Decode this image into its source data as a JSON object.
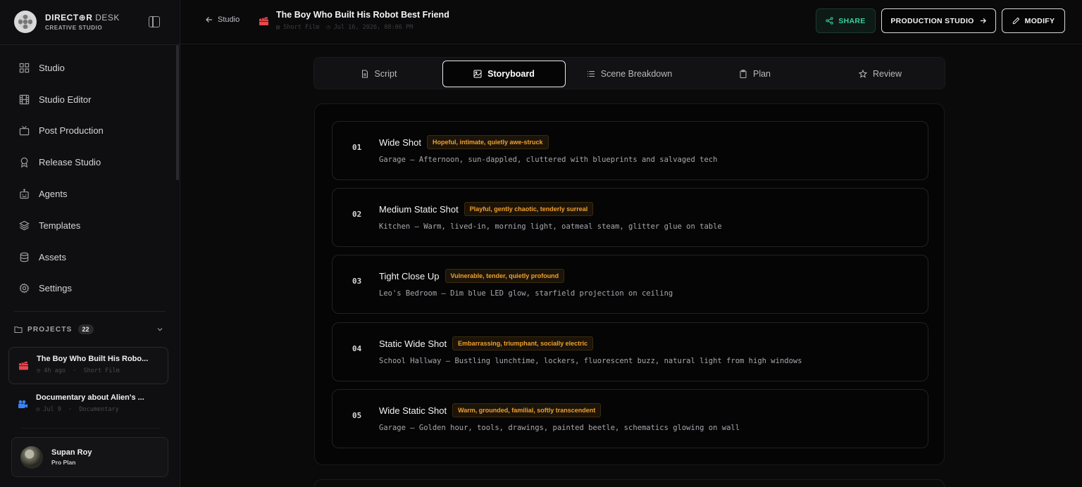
{
  "brand": {
    "name_bold": "DIRECT⊕R",
    "name_light": "DESK",
    "subtitle": "CREATIVE STUDIO"
  },
  "sidebar": {
    "items": [
      {
        "label": "Studio",
        "icon": "grid-icon"
      },
      {
        "label": "Studio Editor",
        "icon": "film-icon"
      },
      {
        "label": "Post Production",
        "icon": "tv-icon"
      },
      {
        "label": "Release Studio",
        "icon": "award-icon"
      },
      {
        "label": "Agents",
        "icon": "bot-icon"
      },
      {
        "label": "Templates",
        "icon": "layers-icon"
      },
      {
        "label": "Assets",
        "icon": "database-icon"
      },
      {
        "label": "Settings",
        "icon": "gear-icon"
      }
    ],
    "projects_label": "PROJECTS",
    "projects_count": "22",
    "projects": [
      {
        "title": "The Boy Who Built His Robo...",
        "time": "4h ago",
        "type": "Short Film",
        "icon": "clapperboard-icon",
        "icon_color": "#e5484d"
      },
      {
        "title": "Documentary about Alien's ...",
        "time": "Jul 9",
        "type": "Documentary",
        "icon": "video-camera-icon",
        "icon_color": "#3b82f6"
      }
    ],
    "user": {
      "name": "Supan Roy",
      "plan": "Pro Plan"
    }
  },
  "header": {
    "back_label": "Studio",
    "title": "The Boy Who Built His Robot Best Friend",
    "meta_type": "Short Film",
    "meta_date": "Jul 16, 2026, 08:06 PM",
    "share_label": "SHARE",
    "production_label": "PRODUCTION STUDIO",
    "modify_label": "MODIFY",
    "share_color": "#3ecf9a"
  },
  "tabs": [
    {
      "label": "Script",
      "icon": "document-icon"
    },
    {
      "label": "Storyboard",
      "icon": "image-icon",
      "active": true
    },
    {
      "label": "Scene Breakdown",
      "icon": "list-icon"
    },
    {
      "label": "Plan",
      "icon": "clipboard-icon"
    },
    {
      "label": "Review",
      "icon": "star-icon"
    }
  ],
  "shots": [
    {
      "num": "01",
      "title": "Wide Shot",
      "mood": "Hopeful, intimate, quietly awe-struck",
      "desc": "Garage — Afternoon, sun-dappled, cluttered with blueprints and salvaged tech"
    },
    {
      "num": "02",
      "title": "Medium Static Shot",
      "mood": "Playful, gently chaotic, tenderly surreal",
      "desc": "Kitchen — Warm, lived-in, morning light, oatmeal steam, glitter glue on table"
    },
    {
      "num": "03",
      "title": "Tight Close Up",
      "mood": "Vulnerable, tender, quietly profound",
      "desc": "Leo's Bedroom — Dim blue LED glow, starfield projection on ceiling"
    },
    {
      "num": "04",
      "title": "Static Wide Shot",
      "mood": "Embarrassing, triumphant, socially electric",
      "desc": "School Hallway — Bustling lunchtime, lockers, fluorescent buzz, natural light from high windows"
    },
    {
      "num": "05",
      "title": "Wide Static Shot",
      "mood": "Warm, grounded, familial, softly transcendent",
      "desc": "Garage — Golden hour, tools, drawings, painted beetle, schematics glowing on wall"
    }
  ],
  "colors": {
    "badge": "#f0a030",
    "accent": "#3ecf9a"
  }
}
